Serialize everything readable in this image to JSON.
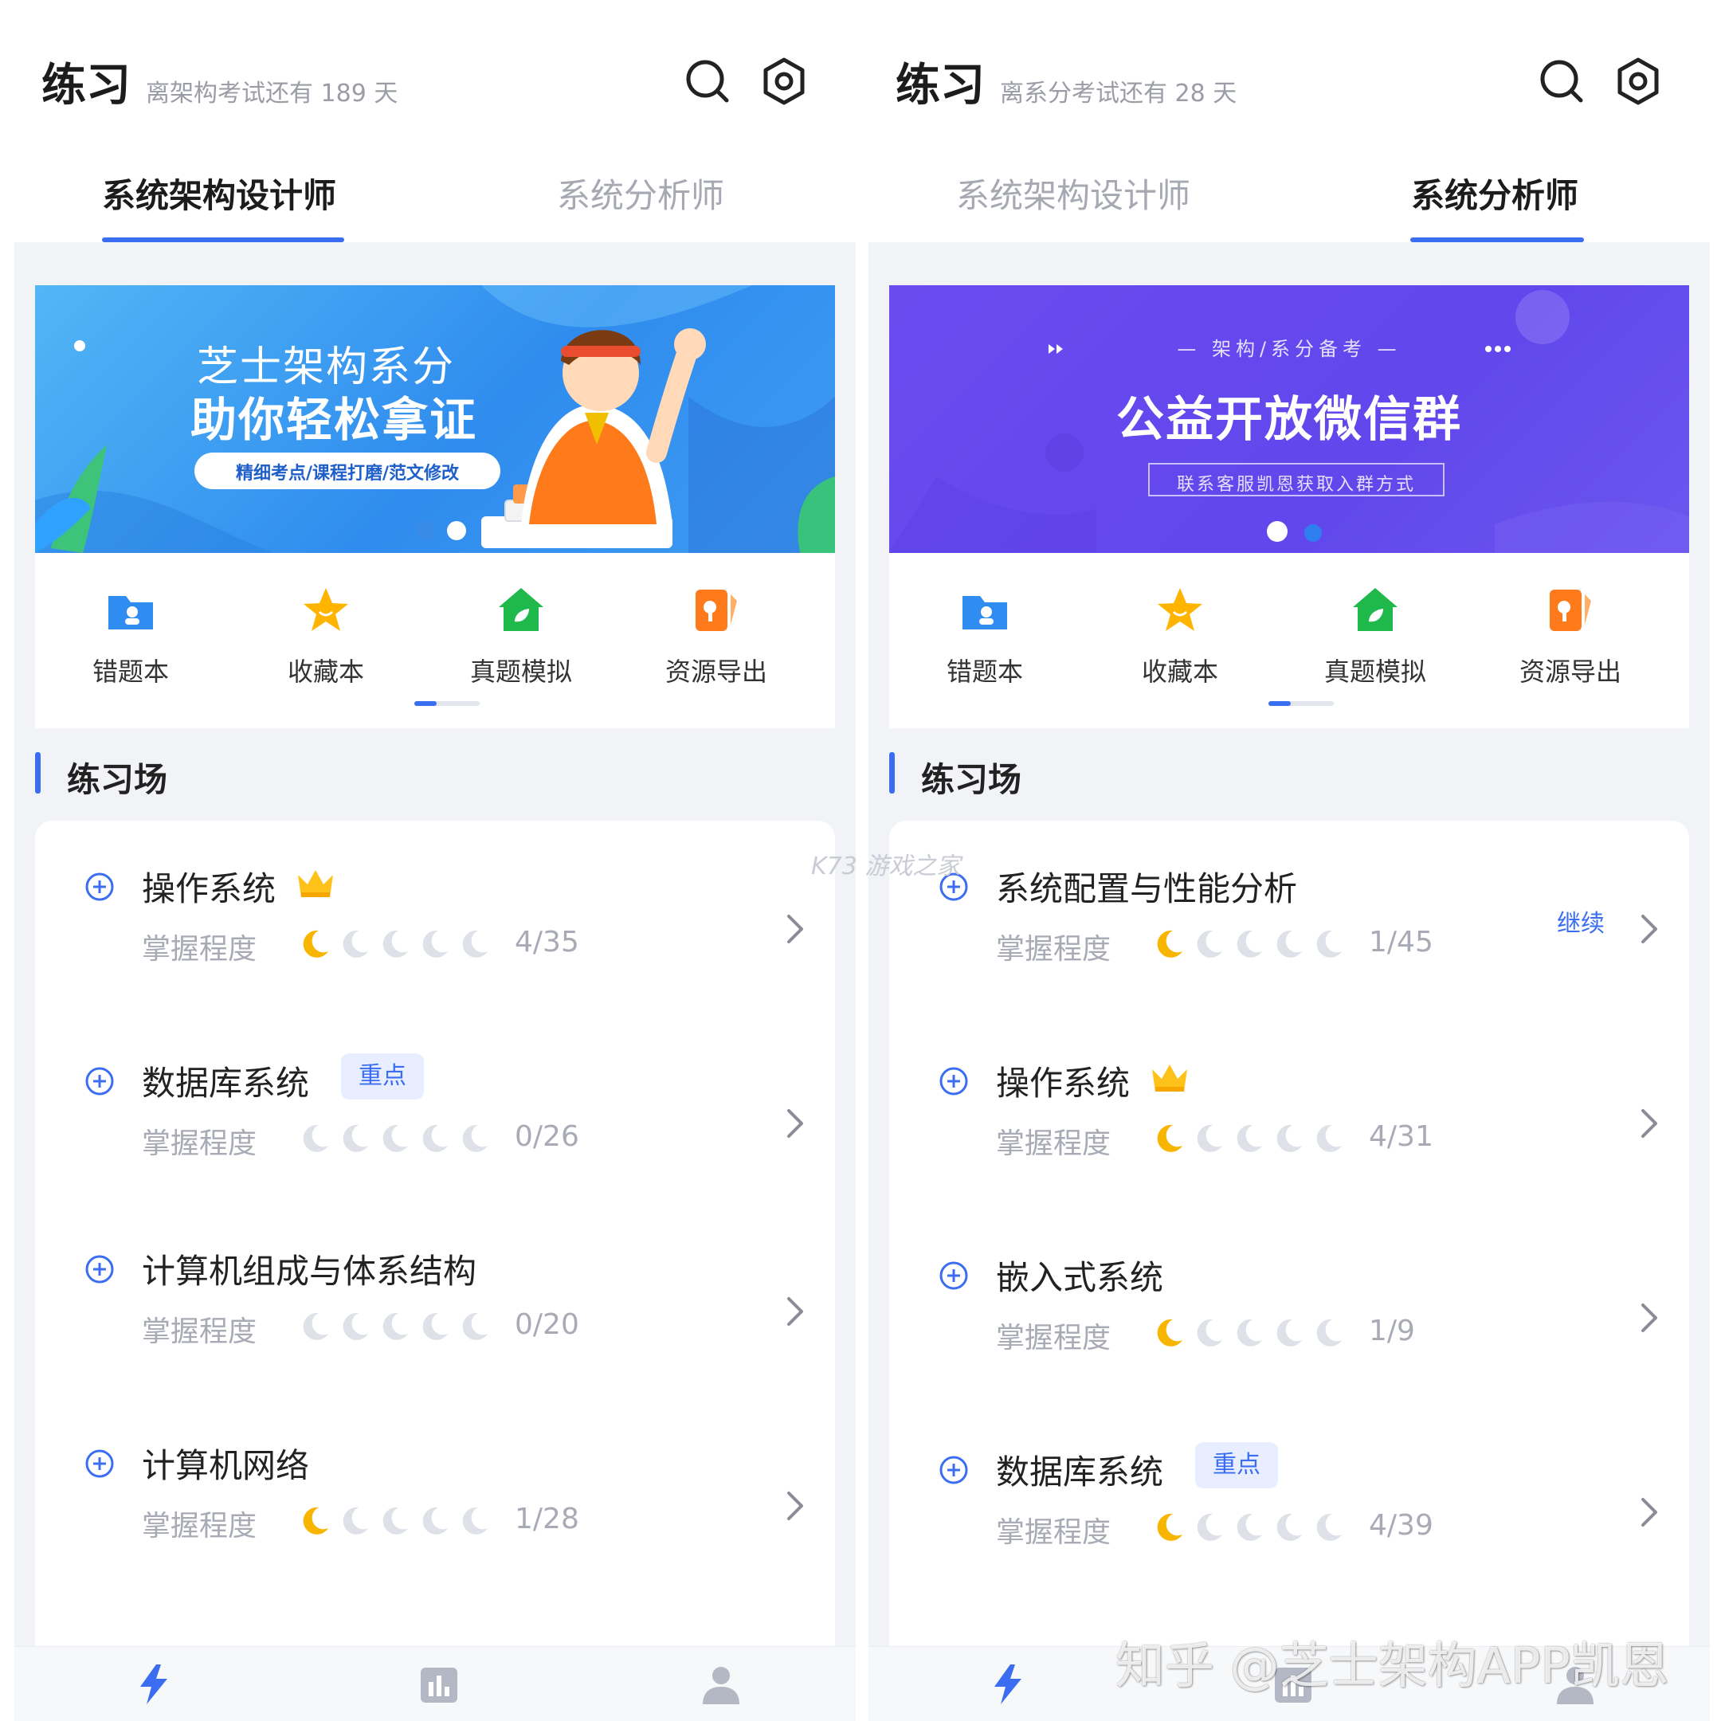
{
  "colors": {
    "accent": "#3a6df0",
    "moon_filled": "#f7b500",
    "moon_empty": "#dfe1e8",
    "banner_blue": "#3f9cf2",
    "banner_purple": "#6147ec"
  },
  "left": {
    "header": {
      "title": "练习",
      "countdown": "离架构考试还有 189 天"
    },
    "tabs": [
      {
        "label": "系统架构设计师",
        "active": true
      },
      {
        "label": "系统分析师",
        "active": false
      }
    ],
    "banner": {
      "line1": "芝士架构系分",
      "line2": "助你轻松拿证",
      "tagline": "精细考点/课程打磨/范文修改",
      "active_dot": 2
    },
    "shortcuts": [
      {
        "label": "错题本",
        "icon": "folder-user-icon"
      },
      {
        "label": "收藏本",
        "icon": "star-icon"
      },
      {
        "label": "真题模拟",
        "icon": "house-leaf-icon"
      },
      {
        "label": "资源导出",
        "icon": "export-card-icon"
      }
    ],
    "section_title": "练习场",
    "items": [
      {
        "name": "操作系统",
        "crown": true,
        "badge": "",
        "mastery_label": "掌握程度",
        "level": 1,
        "progress": "4/35",
        "continue": ""
      },
      {
        "name": "数据库系统",
        "crown": false,
        "badge": "重点",
        "mastery_label": "掌握程度",
        "level": 0,
        "progress": "0/26",
        "continue": ""
      },
      {
        "name": "计算机组成与体系结构",
        "crown": false,
        "badge": "",
        "mastery_label": "掌握程度",
        "level": 0,
        "progress": "0/20",
        "continue": ""
      },
      {
        "name": "计算机网络",
        "crown": false,
        "badge": "",
        "mastery_label": "掌握程度",
        "level": 1,
        "progress": "1/28",
        "continue": ""
      }
    ]
  },
  "right": {
    "header": {
      "title": "练习",
      "countdown": "离系分考试还有 28 天"
    },
    "tabs": [
      {
        "label": "系统架构设计师",
        "active": false
      },
      {
        "label": "系统分析师",
        "active": true
      }
    ],
    "banner": {
      "kicker": "— 架构/系分备考 —",
      "line1": "公益开放微信群",
      "tagline": "联系客服凯恩获取入群方式",
      "active_dot": 1
    },
    "shortcuts": [
      {
        "label": "错题本",
        "icon": "folder-user-icon"
      },
      {
        "label": "收藏本",
        "icon": "star-icon"
      },
      {
        "label": "真题模拟",
        "icon": "house-leaf-icon"
      },
      {
        "label": "资源导出",
        "icon": "export-card-icon"
      }
    ],
    "section_title": "练习场",
    "items": [
      {
        "name": "系统配置与性能分析",
        "crown": false,
        "badge": "",
        "mastery_label": "掌握程度",
        "level": 1,
        "progress": "1/45",
        "continue": "继续"
      },
      {
        "name": "操作系统",
        "crown": true,
        "badge": "",
        "mastery_label": "掌握程度",
        "level": 1,
        "progress": "4/31",
        "continue": ""
      },
      {
        "name": "嵌入式系统",
        "crown": false,
        "badge": "",
        "mastery_label": "掌握程度",
        "level": 1,
        "progress": "1/9",
        "continue": ""
      },
      {
        "name": "数据库系统",
        "crown": false,
        "badge": "重点",
        "mastery_label": "掌握程度",
        "level": 1,
        "progress": "4/39",
        "continue": ""
      }
    ]
  },
  "watermarks": {
    "site": "K73 游戏之家",
    "zhihu": "知乎 @芝士架构APP凯恩"
  },
  "bottom_nav": [
    {
      "icon": "lightning-icon",
      "active": true
    },
    {
      "icon": "chart-icon",
      "active": false
    },
    {
      "icon": "profile-icon",
      "active": false
    }
  ]
}
